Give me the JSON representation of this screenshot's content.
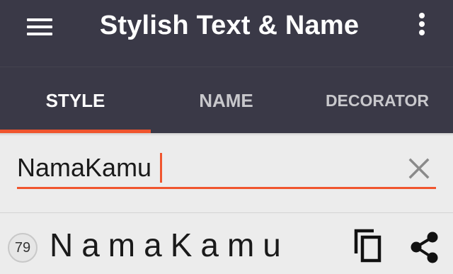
{
  "toolbar": {
    "title": "Stylish Text & Name",
    "menu_icon": "hamburger-menu-icon",
    "overflow_icon": "more-vertical-icon"
  },
  "tabs": [
    {
      "label": "STYLE",
      "selected": true
    },
    {
      "label": "NAME",
      "selected": false
    },
    {
      "label": "DECORATOR",
      "selected": false
    }
  ],
  "input": {
    "value": "NamaKamu",
    "clear_icon": "close-icon"
  },
  "results": [
    {
      "number": "79",
      "styled_text": "NamaKamu",
      "copy_icon": "copy-icon",
      "share_icon": "share-icon"
    }
  ],
  "colors": {
    "app_bar": "#3a3947",
    "accent": "#f0552e",
    "background": "#ececec"
  }
}
